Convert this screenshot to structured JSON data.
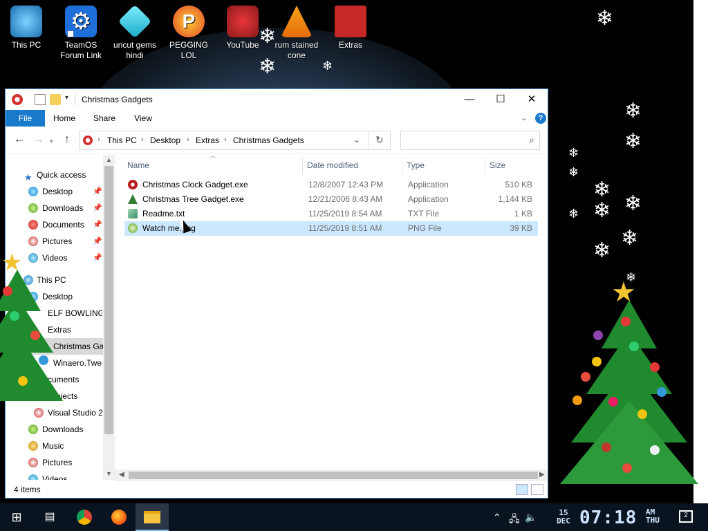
{
  "desktop": {
    "icons": [
      {
        "label": "This PC"
      },
      {
        "label": "TeamOS Forum Link"
      },
      {
        "label": "uncut gems hindi"
      },
      {
        "label": "PEGGING LOL"
      },
      {
        "label": "YouTube"
      },
      {
        "label": "rum stained cone"
      },
      {
        "label": "Extras"
      }
    ]
  },
  "window": {
    "title": "Christmas Gadgets",
    "controls": {
      "minimize": "—",
      "maximize": "☐",
      "close": "✕"
    },
    "ribbon": {
      "file": "File",
      "home": "Home",
      "share": "Share",
      "view": "View",
      "help": "?"
    },
    "address": {
      "crumbs": [
        "This PC",
        "Desktop",
        "Extras",
        "Christmas Gadgets"
      ]
    },
    "search": {
      "placeholder": ""
    },
    "nav": [
      {
        "label": "Quick access",
        "pinned": false
      },
      {
        "label": "Desktop",
        "pinned": true
      },
      {
        "label": "Downloads",
        "pinned": true
      },
      {
        "label": "Documents",
        "pinned": true
      },
      {
        "label": "Pictures",
        "pinned": true
      },
      {
        "label": "Videos",
        "pinned": true
      },
      {
        "label": "This PC",
        "pinned": false
      },
      {
        "label": "Desktop",
        "pinned": false
      },
      {
        "label": "ELF BOWLING",
        "pinned": false
      },
      {
        "label": "Extras",
        "pinned": false
      },
      {
        "label": "Christmas Ga",
        "pinned": false
      },
      {
        "label": "Winaero.Twea",
        "pinned": false
      },
      {
        "label": "cuments",
        "pinned": false
      },
      {
        "label": "Projects",
        "pinned": false
      },
      {
        "label": "Visual Studio 2",
        "pinned": false
      },
      {
        "label": "Downloads",
        "pinned": false
      },
      {
        "label": "Music",
        "pinned": false
      },
      {
        "label": "Pictures",
        "pinned": false
      },
      {
        "label": "Videos",
        "pinned": false
      }
    ],
    "columns": {
      "name": "Name",
      "date": "Date modified",
      "type": "Type",
      "size": "Size"
    },
    "files": [
      {
        "name": "Christmas Clock Gadget.exe",
        "date": "12/8/2007 12:43 PM",
        "type": "Application",
        "size": "510 KB",
        "selected": false
      },
      {
        "name": "Christmas Tree Gadget.exe",
        "date": "12/21/2006 8:43 AM",
        "type": "Application",
        "size": "1,144 KB",
        "selected": false
      },
      {
        "name": "Readme.txt",
        "date": "11/25/2019 8:54 AM",
        "type": "TXT File",
        "size": "1 KB",
        "selected": false
      },
      {
        "name": "Watch me.png",
        "date": "11/25/2019 8:51 AM",
        "type": "PNG File",
        "size": "39 KB",
        "selected": true
      }
    ],
    "status": {
      "count": "4 items"
    }
  },
  "taskbar": {
    "date_day": "15",
    "date_month": "DEC",
    "time": "07:18",
    "ampm": "AM",
    "weekday": "THU",
    "notifications": "2"
  },
  "colors": {
    "accent": "#1979ca",
    "selection": "#cce8ff",
    "header_text": "#4c607a"
  }
}
